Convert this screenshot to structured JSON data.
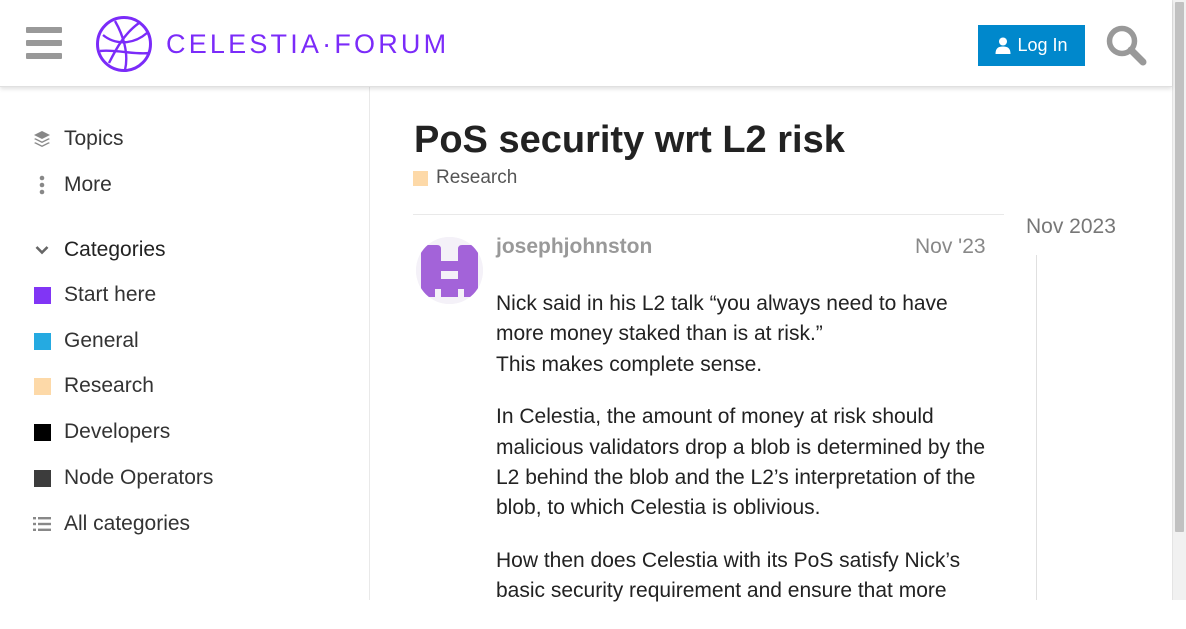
{
  "header": {
    "logo_text": "CELESTIA·FORUM",
    "login_label": "Log In",
    "brand_color": "#7b2bf9",
    "login_color": "#0088cc"
  },
  "sidebar": {
    "nav": [
      {
        "label": "Topics",
        "icon": "layers-icon"
      },
      {
        "label": "More",
        "icon": "vertical-ellipsis-icon"
      }
    ],
    "categories_label": "Categories",
    "categories": [
      {
        "label": "Start here",
        "color": "#8135f5"
      },
      {
        "label": "General",
        "color": "#25aae1"
      },
      {
        "label": "Research",
        "color": "#fdd9a8"
      },
      {
        "label": "Developers",
        "color": "#000000"
      },
      {
        "label": "Node Operators",
        "color": "#3c3c3c"
      }
    ],
    "all_categories_label": "All categories"
  },
  "topic": {
    "title": "PoS security wrt L2 risk",
    "category": "Research",
    "category_color": "#fdd9a8"
  },
  "post": {
    "username": "josephjohnston",
    "date": "Nov '23",
    "avatar_color": "#a363d9",
    "paragraphs": [
      [
        "Nick said in his L2 talk “you always need to have more money staked than is at risk.”",
        "This makes complete sense."
      ],
      [
        "In Celestia, the amount of money at risk should malicious validators drop a blob is determined by the L2 behind the blob and the L2’s interpretation of the blob, to which Celestia is oblivious."
      ],
      [
        "How then does Celestia with its PoS satisfy Nick’s basic security requirement and ensure that more"
      ]
    ]
  },
  "timeline": {
    "date": "Nov 2023"
  }
}
